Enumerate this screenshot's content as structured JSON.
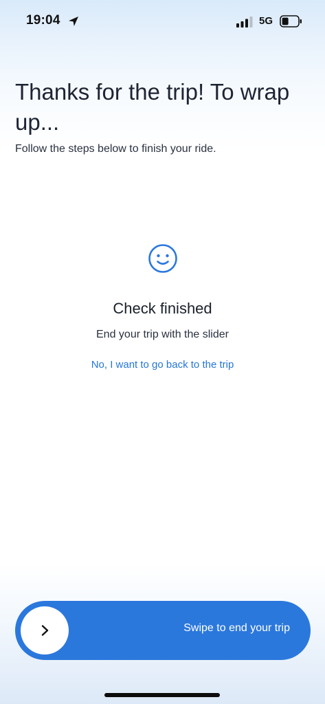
{
  "status_bar": {
    "time": "19:04",
    "network": "5G",
    "icons": [
      "location-arrow-icon",
      "signal-bars-icon",
      "battery-icon"
    ]
  },
  "header": {
    "title": "Thanks for the trip! To wrap up...",
    "subtitle": "Follow the steps below to finish your ride."
  },
  "check": {
    "icon": "smiley-face-icon",
    "title": "Check finished",
    "subtitle": "End your trip with the slider",
    "back_link": "No, I want to go back to the trip"
  },
  "slider": {
    "label": "Swipe to end your trip",
    "knob_icon": "chevron-right-icon"
  },
  "colors": {
    "accent": "#2b78dd",
    "link": "#2476d9",
    "text": "#1e2433"
  }
}
